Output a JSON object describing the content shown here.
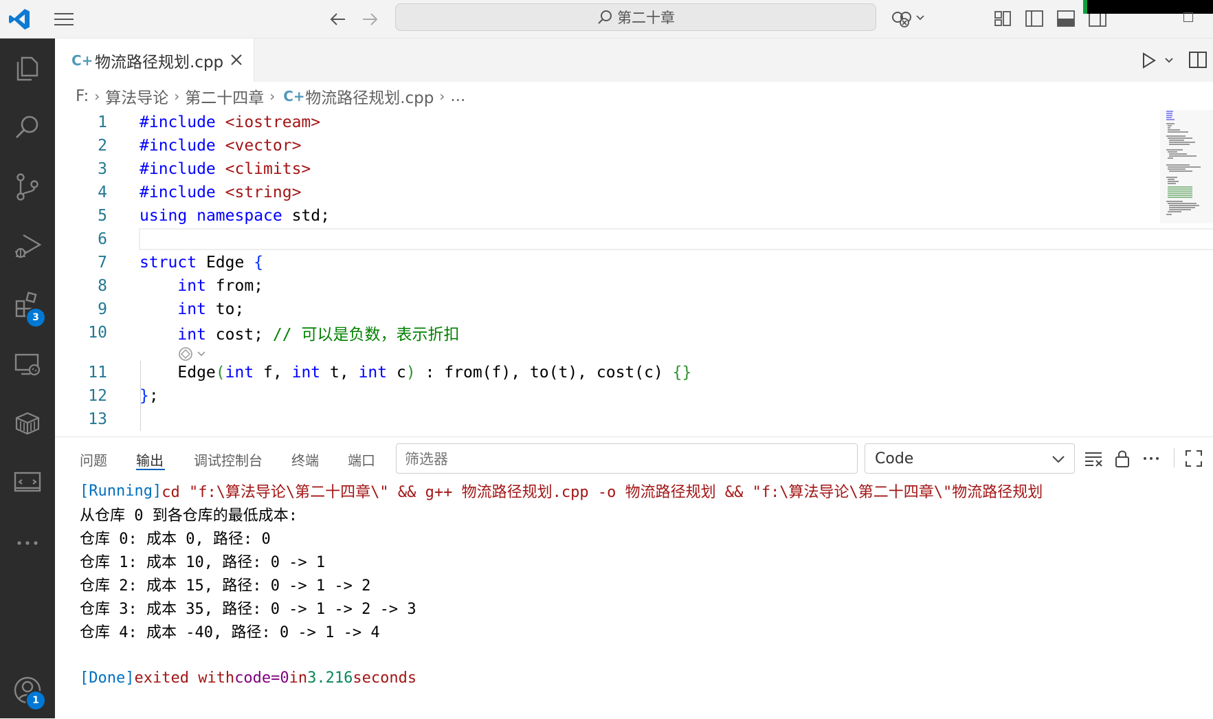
{
  "titlebar": {
    "search_text": "第二十章"
  },
  "tab": {
    "filename": "物流路径规划.cpp",
    "icon_label": "C+"
  },
  "breadcrumb": {
    "drive": "F:",
    "folder1": "算法导论",
    "folder2": "第二十四章",
    "file": "物流路径规划.cpp",
    "more": "..."
  },
  "badges": {
    "extensions": "3",
    "accounts": "1"
  },
  "code": {
    "line_numbers": [
      "1",
      "2",
      "3",
      "4",
      "5",
      "6",
      "7",
      "8",
      "9",
      "10",
      "11",
      "12",
      "13"
    ],
    "l1": {
      "kw": "#include",
      "str": "<iostream>"
    },
    "l2": {
      "kw": "#include",
      "str": "<vector>"
    },
    "l3": {
      "kw": "#include",
      "str": "<climits>"
    },
    "l4": {
      "kw": "#include",
      "str": "<string>"
    },
    "l5": {
      "kw1": "using",
      "kw2": "namespace",
      "rest": "std;"
    },
    "l7": {
      "kw": "struct",
      "name": "Edge",
      "brace": "{"
    },
    "l8": {
      "ty": "int",
      "rest": "from;"
    },
    "l9": {
      "ty": "int",
      "rest": "to;"
    },
    "l10": {
      "ty": "int",
      "rest": "cost;",
      "comment": "// 可以是负数，表示折扣"
    },
    "l11": {
      "fn": "Edge",
      "p1": "(",
      "t1": "int",
      "a1": "f,",
      "t2": "int",
      "a2": "t,",
      "t3": "int",
      "a3": "c",
      "p2": ")",
      "colon": ":",
      "m1": "from",
      "m1a": "(f),",
      "m2": "to",
      "m2a": "(t),",
      "m3": "cost",
      "m3a": "(c)",
      "body": "{}"
    },
    "l12": {
      "brace": "}",
      "semi": ";"
    }
  },
  "panel": {
    "tabs": [
      "问题",
      "输出",
      "调试控制台",
      "终端",
      "端口"
    ],
    "active_tab": "输出",
    "filter_placeholder": "筛选器",
    "source": "Code"
  },
  "output": {
    "running_tag": "[Running]",
    "running_cmd": "cd \"f:\\算法导论\\第二十四章\\\" && g++ 物流路径规划.cpp -o 物流路径规划 && \"f:\\算法导论\\第二十四章\\\"物流路径规划",
    "lines": [
      "从仓库 0 到各仓库的最低成本:",
      "仓库 0: 成本 0, 路径: 0",
      "仓库 1: 成本 10, 路径: 0 -> 1",
      "仓库 2: 成本 15, 路径: 0 -> 1 -> 2",
      "仓库 3: 成本 35, 路径: 0 -> 1 -> 2 -> 3",
      "仓库 4: 成本 -40, 路径: 0 -> 1 -> 4"
    ],
    "done_tag": "[Done]",
    "done_a": "exited with",
    "done_code": "code=0",
    "done_in": "in",
    "done_secs": "3.216",
    "done_seconds": "seconds"
  },
  "colors": {
    "activity_bar": "#2c2c2c",
    "accent": "#0078d4",
    "keyword": "#0000ff",
    "string": "#a31515",
    "comment": "#008000"
  }
}
